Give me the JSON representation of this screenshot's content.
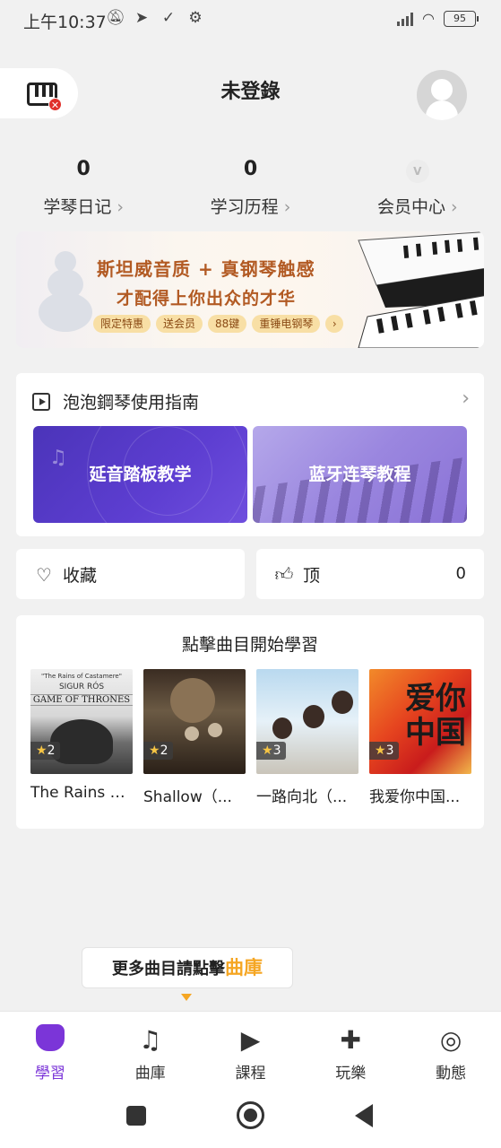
{
  "status_bar": {
    "time": "上午10:37",
    "battery": "95",
    "icons": [
      "mute-icon",
      "telegram-icon",
      "check-icon",
      "gear-icon"
    ]
  },
  "header": {
    "title": "未登錄"
  },
  "stats": [
    {
      "value": "0",
      "label": "学琴日记"
    },
    {
      "value": "0",
      "label": "学习历程"
    },
    {
      "value": "",
      "label": "会员中心"
    }
  ],
  "vip_letter": "V",
  "banner": {
    "line1": "斯坦威音质 + 真钢琴触感",
    "line2": "才配得上你出众的才华",
    "tags": [
      "限定特惠",
      "送会员",
      "88键",
      "重锤电钢琴"
    ]
  },
  "guide": {
    "title": "泡泡鋼琴使用指南",
    "buttons": [
      "延音踏板教学",
      "蓝牙连琴教程"
    ]
  },
  "actions": {
    "favorite_label": "收藏",
    "like_label": "顶",
    "like_count": "0"
  },
  "songs": {
    "title": "點擊曲目開始學習",
    "items": [
      {
        "name": "The Rains o...",
        "stars": "2",
        "cover_lines": [
          "\"The Rains of Castamere\"",
          "SIGUR RÓS",
          "GAME OF THRONES"
        ]
      },
      {
        "name": "Shallow（...",
        "stars": "2"
      },
      {
        "name": "一路向北（...",
        "stars": "3"
      },
      {
        "name": "我爱你中国...",
        "stars": "3",
        "cover_text": "爱你中国"
      }
    ]
  },
  "more": {
    "prefix": "更多曲目請點擊",
    "highlight": "曲庫"
  },
  "bottom_nav": [
    {
      "label": "學習",
      "icon": "piano-icon",
      "active": true
    },
    {
      "label": "曲庫",
      "icon": "music-library-icon",
      "active": false
    },
    {
      "label": "課程",
      "icon": "course-icon",
      "active": false
    },
    {
      "label": "玩樂",
      "icon": "gamepad-icon",
      "active": false
    },
    {
      "label": "動態",
      "icon": "planet-icon",
      "active": false
    }
  ],
  "colors": {
    "accent": "#7b35d8",
    "highlight": "#f5a623",
    "banner_text": "#b25a23"
  }
}
